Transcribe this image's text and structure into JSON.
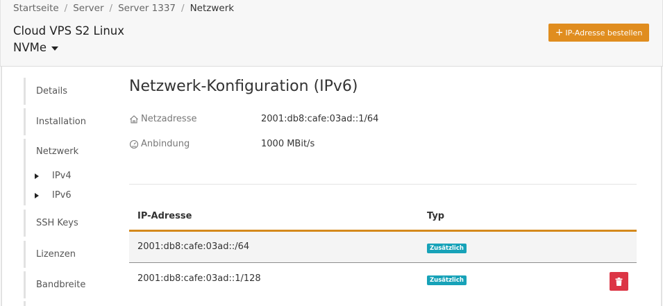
{
  "breadcrumb": [
    {
      "label": "Startseite"
    },
    {
      "label": "Server"
    },
    {
      "label": "Server 1337"
    },
    {
      "label": "Netzwerk"
    }
  ],
  "server": {
    "title_line1": "Cloud VPS S2 Linux",
    "title_line2": "NVMe"
  },
  "header": {
    "order_button_label": "IP-Adresse bestellen",
    "order_button_color": "#e08d1f"
  },
  "sidebar": {
    "items": [
      {
        "label": "Details"
      },
      {
        "label": "Installation"
      },
      {
        "label": "Netzwerk"
      },
      {
        "label": "IPv4"
      },
      {
        "label": "IPv6"
      },
      {
        "label": "SSH Keys"
      },
      {
        "label": "Lizenzen"
      },
      {
        "label": "Bandbreite"
      }
    ]
  },
  "main": {
    "title": "Netzwerk-Konfiguration (IPv6)",
    "network_address_label": "Netzadresse",
    "network_address_value": "2001:db8:cafe:03ad::1/64",
    "connection_label": "Anbindung",
    "connection_value": "1000 MBit/s"
  },
  "table": {
    "headers": {
      "ip": "IP-Adresse",
      "type": "Typ"
    },
    "rows": [
      {
        "ip": "2001:db8:cafe:03ad::/64",
        "type": "Zusätzlich"
      },
      {
        "ip": "2001:db8:cafe:03ad::1/128",
        "type": "Zusätzlich"
      }
    ],
    "header_border_color": "#d4891c",
    "badge_color": "#17a2b8",
    "delete_color": "#dc3545"
  },
  "icons": {
    "network_address": "home-icon",
    "connection": "speedometer-icon",
    "delete": "trash-icon",
    "order": "plus-icon",
    "server_menu": "caret-down-icon",
    "submenu": "triangle-right-icon"
  }
}
